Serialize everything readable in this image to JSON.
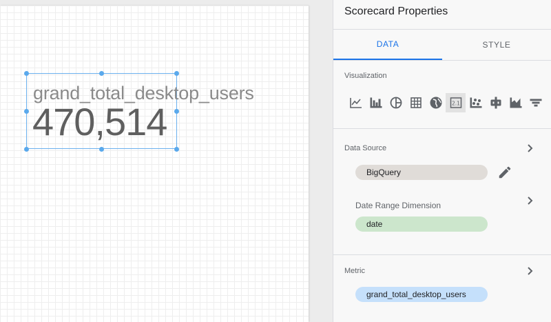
{
  "canvas": {
    "scorecard": {
      "label": "grand_total_desktop_users",
      "value": "470,514"
    }
  },
  "panel": {
    "title": "Scorecard Properties",
    "tabs": [
      {
        "label": "DATA",
        "active": true
      },
      {
        "label": "STYLE",
        "active": false
      }
    ],
    "visualization": {
      "label": "Visualization",
      "icons": [
        "time-series-icon",
        "bar-chart-icon",
        "pie-chart-icon",
        "table-icon",
        "geo-map-icon",
        "scorecard-icon",
        "scatter-chart-icon",
        "pivot-table-icon",
        "area-chart-icon",
        "filter-control-icon"
      ],
      "selected": "scorecard-icon"
    },
    "data_source": {
      "label": "Data Source",
      "source_chip": "BigQuery",
      "date_range_label": "Date Range Dimension",
      "date_chip": "date"
    },
    "metric": {
      "label": "Metric",
      "metric_chip": "grand_total_desktop_users"
    }
  },
  "colors": {
    "accent": "#1a73e8",
    "source_chip": "#e0dcd8",
    "dimension_chip": "#cce6cc",
    "metric_chip": "#c5e0fb",
    "selection": "#6ab0ee"
  }
}
